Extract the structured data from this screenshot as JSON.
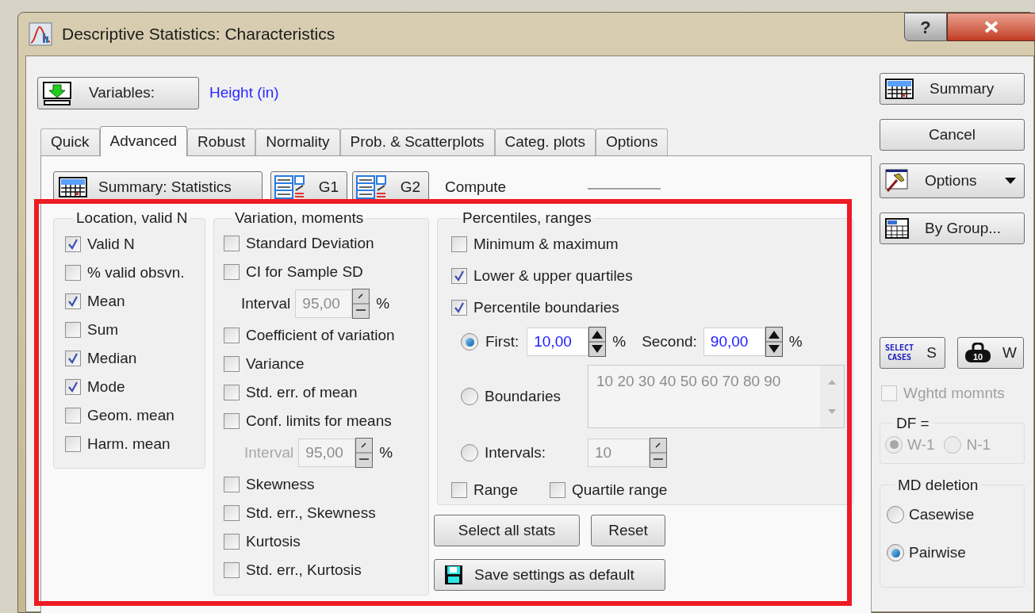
{
  "window": {
    "title": "Descriptive Statistics: Characteristics",
    "help": "?"
  },
  "variables": {
    "button": "Variables:",
    "value": "Height (in)"
  },
  "tabs": [
    {
      "label": "Quick",
      "selected": false
    },
    {
      "label": "Advanced",
      "selected": true
    },
    {
      "label": "Robust",
      "selected": false
    },
    {
      "label": "Normality",
      "selected": false
    },
    {
      "label": "Prob. & Scatterplots",
      "selected": false
    },
    {
      "label": "Categ. plots",
      "selected": false
    },
    {
      "label": "Options",
      "selected": false
    }
  ],
  "toolbar": {
    "summary": "Summary: Statistics",
    "g1": "G1",
    "g2": "G2",
    "compute": "Compute"
  },
  "location": {
    "title": "Location, valid N",
    "items": [
      {
        "label": "Valid N",
        "checked": true
      },
      {
        "label": "% valid obsvn.",
        "checked": false
      },
      {
        "label": "Mean",
        "checked": true
      },
      {
        "label": "Sum",
        "checked": false
      },
      {
        "label": "Median",
        "checked": true
      },
      {
        "label": "Mode",
        "checked": true
      },
      {
        "label": "Geom. mean",
        "checked": false
      },
      {
        "label": "Harm. mean",
        "checked": false
      }
    ]
  },
  "variation": {
    "title": "Variation, moments",
    "items": [
      {
        "kind": "checkbox",
        "label": "Standard Deviation",
        "checked": false
      },
      {
        "kind": "checkbox",
        "label": "CI for Sample SD",
        "checked": false
      },
      {
        "kind": "spin",
        "label": "Interval",
        "value": "95,00",
        "unit": "%",
        "label_disabled": false
      },
      {
        "kind": "checkbox",
        "label": "Coefficient of variation",
        "checked": false
      },
      {
        "kind": "checkbox",
        "label": "Variance",
        "checked": false
      },
      {
        "kind": "checkbox",
        "label": "Std. err. of mean",
        "checked": false
      },
      {
        "kind": "checkbox",
        "label": "Conf. limits for means",
        "checked": false
      },
      {
        "kind": "spin",
        "label": "Interval",
        "value": "95,00",
        "unit": "%",
        "label_disabled": true
      },
      {
        "kind": "checkbox",
        "label": "Skewness",
        "checked": false
      },
      {
        "kind": "checkbox",
        "label": "Std. err., Skewness",
        "checked": false
      },
      {
        "kind": "checkbox",
        "label": "Kurtosis",
        "checked": false
      },
      {
        "kind": "checkbox",
        "label": "Std. err., Kurtosis",
        "checked": false
      }
    ]
  },
  "percentiles": {
    "title": "Percentiles, ranges",
    "checks": [
      {
        "label": "Minimum & maximum",
        "checked": false
      },
      {
        "label": "Lower & upper quartiles",
        "checked": true
      },
      {
        "label": "Percentile boundaries",
        "checked": true
      }
    ],
    "first": {
      "label": "First:",
      "selected": true,
      "value": "10,00",
      "unit": "%",
      "second_label": "Second:",
      "second_value": "90,00",
      "second_unit": "%"
    },
    "boundaries": {
      "label": "Boundaries",
      "selected": false,
      "value": "10 20 30 40 50 60 70 80 90"
    },
    "intervals": {
      "label": "Intervals:",
      "selected": false,
      "value": "10"
    },
    "range_checks": [
      {
        "label": "Range",
        "checked": false
      },
      {
        "label": "Quartile range",
        "checked": false
      }
    ]
  },
  "select_all_button": "Select all stats",
  "reset_button": "Reset",
  "save_button": "Save settings as default",
  "side": {
    "summary": "Summary",
    "cancel": "Cancel",
    "options": "Options",
    "by_group": "By Group...",
    "select_cases": {
      "icon_text": "SELECT CASES",
      "label": "S"
    },
    "weight": {
      "icon_text": "10",
      "label": "W"
    },
    "weighted_moments": {
      "label": "Wghtd momnts",
      "checked": false,
      "disabled": true
    },
    "df": {
      "title": "DF =",
      "options": [
        {
          "label": "W-1",
          "selected": true,
          "disabled": true
        },
        {
          "label": "N-1",
          "selected": false,
          "disabled": true
        }
      ]
    },
    "md_deletion": {
      "title": "MD deletion",
      "options": [
        {
          "label": "Casewise",
          "selected": false,
          "disabled": false
        },
        {
          "label": "Pairwise",
          "selected": true,
          "disabled": false
        }
      ]
    }
  }
}
